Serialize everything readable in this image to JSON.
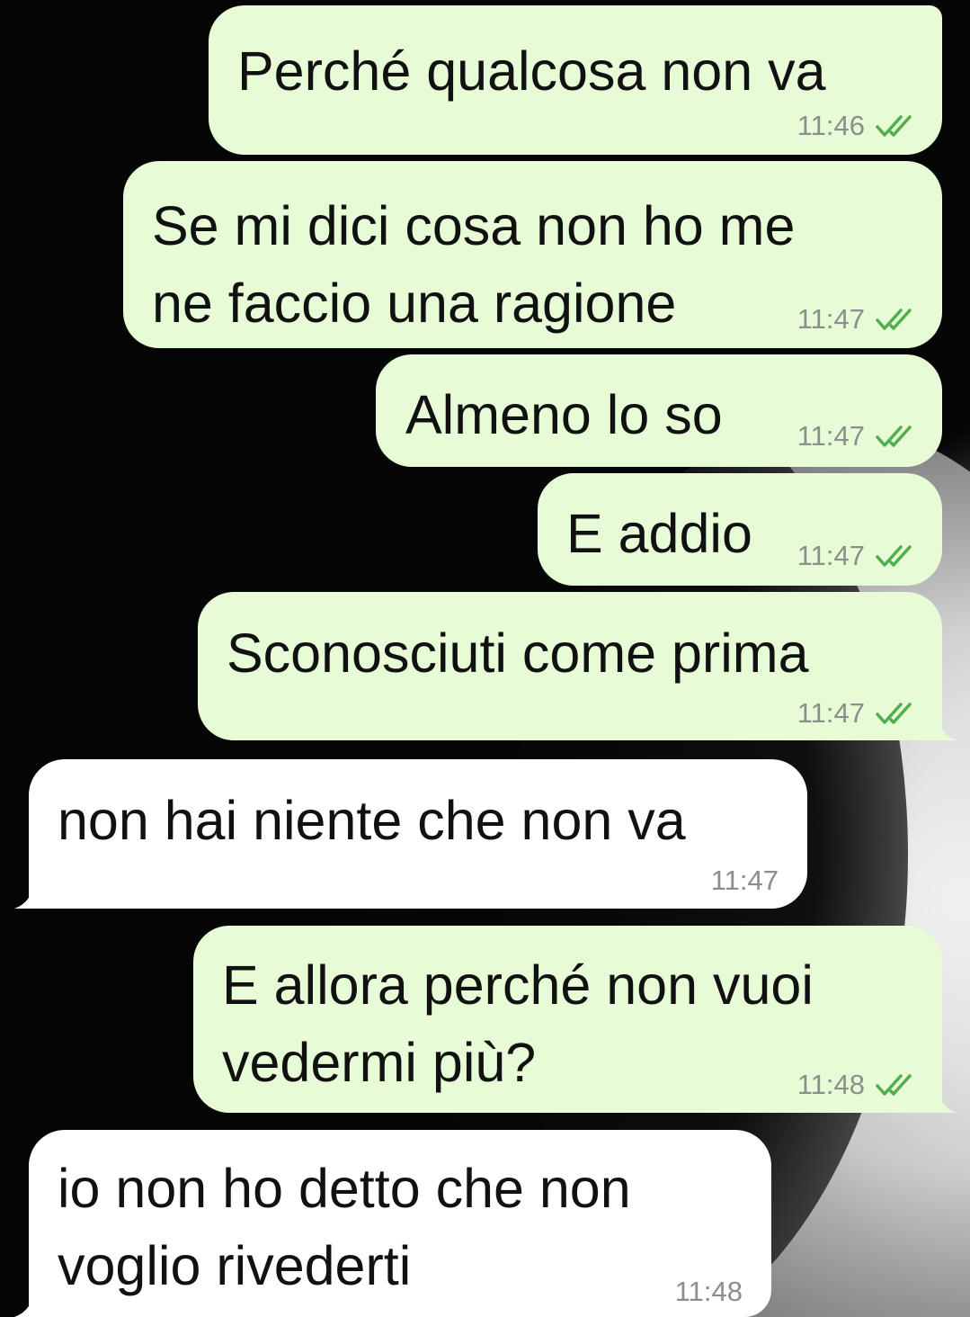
{
  "chat": {
    "messages": [
      {
        "direction": "out",
        "text": "Perché qualcosa non va",
        "time": "11:46",
        "status": "read"
      },
      {
        "direction": "out",
        "text": "Se mi dici cosa non ho me\nne faccio una ragione",
        "time": "11:47",
        "status": "read"
      },
      {
        "direction": "out",
        "text": "Almeno lo so",
        "time": "11:47",
        "status": "read"
      },
      {
        "direction": "out",
        "text": "E addio",
        "time": "11:47",
        "status": "read"
      },
      {
        "direction": "out",
        "text": "Sconosciuti come prima",
        "time": "11:47",
        "status": "read"
      },
      {
        "direction": "in",
        "text": "non hai niente che non va",
        "time": "11:47"
      },
      {
        "direction": "out",
        "text": "E allora perché non vuoi\nvedermi più?",
        "time": "11:48",
        "status": "read"
      },
      {
        "direction": "in",
        "text": "io non ho detto che non\nvoglio rivederti",
        "time": "11:48"
      }
    ]
  },
  "colors": {
    "outgoing_bubble": "#e7fcd6",
    "incoming_bubble": "#ffffff",
    "read_ticks": "#4fae4e",
    "timestamp": "#8a8f8c"
  },
  "icons": {
    "read_receipt": "double-check-icon"
  }
}
